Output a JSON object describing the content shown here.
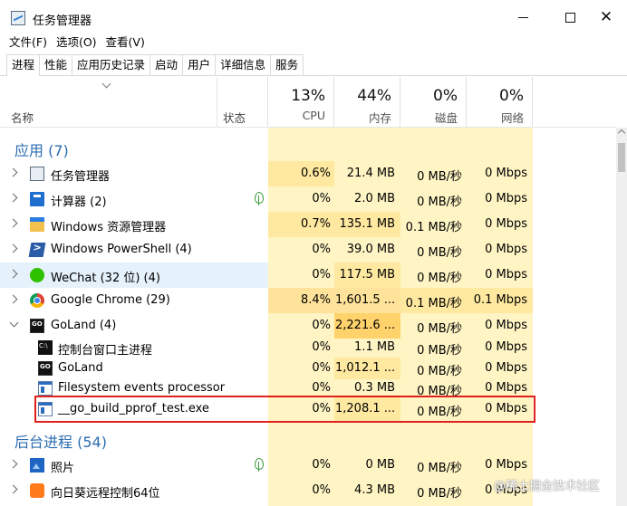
{
  "window": {
    "title": "任务管理器"
  },
  "menu": [
    "文件(F)",
    "选项(O)",
    "查看(V)"
  ],
  "tabs": [
    "进程",
    "性能",
    "应用历史记录",
    "启动",
    "用户",
    "详细信息",
    "服务"
  ],
  "columns": {
    "name": "名称",
    "status": "状态",
    "cpu": {
      "pct": "13%",
      "label": "CPU"
    },
    "memory": {
      "pct": "44%",
      "label": "内存"
    },
    "disk": {
      "pct": "0%",
      "label": "磁盘"
    },
    "network": {
      "pct": "0%",
      "label": "网络"
    }
  },
  "sections": {
    "apps": "应用 (7)",
    "background": "后台进程 (54)"
  },
  "rows": [
    {
      "name": "任务管理器",
      "icon": "task-manager-icon",
      "cpu": "0.6%",
      "mem": "21.4 MB",
      "disk": "0 MB/秒",
      "net": "0 Mbps"
    },
    {
      "name": "计算器 (2)",
      "icon": "calculator-icon",
      "cpu": "0%",
      "mem": "2.0 MB",
      "disk": "0 MB/秒",
      "net": "0 Mbps"
    },
    {
      "name": "Windows 资源管理器",
      "icon": "folder-icon",
      "cpu": "0.7%",
      "mem": "135.1 MB",
      "disk": "0.1 MB/秒",
      "net": "0 Mbps"
    },
    {
      "name": "Windows PowerShell (4)",
      "icon": "powershell-icon",
      "cpu": "0%",
      "mem": "39.0 MB",
      "disk": "0 MB/秒",
      "net": "0 Mbps"
    },
    {
      "name": "WeChat (32 位) (4)",
      "icon": "wechat-icon",
      "cpu": "0%",
      "mem": "117.5 MB",
      "disk": "0 MB/秒",
      "net": "0 Mbps"
    },
    {
      "name": "Google Chrome (29)",
      "icon": "chrome-icon",
      "cpu": "8.4%",
      "mem": "1,601.5 ...",
      "disk": "0.1 MB/秒",
      "net": "0.1 Mbps"
    },
    {
      "name": "GoLand (4)",
      "icon": "goland-icon",
      "cpu": "0%",
      "mem": "2,221.6 ...",
      "disk": "0 MB/秒",
      "net": "0 Mbps"
    },
    {
      "name": "控制台窗口主进程",
      "icon": "console-icon",
      "cpu": "0%",
      "mem": "1.1 MB",
      "disk": "0 MB/秒",
      "net": "0 Mbps"
    },
    {
      "name": "GoLand",
      "icon": "goland-icon",
      "cpu": "0%",
      "mem": "1,012.1 ...",
      "disk": "0 MB/秒",
      "net": "0 Mbps"
    },
    {
      "name": "Filesystem events processor",
      "icon": "window-icon",
      "cpu": "0%",
      "mem": "0.3 MB",
      "disk": "0 MB/秒",
      "net": "0 Mbps"
    },
    {
      "name": "__go_build_pprof_test.exe",
      "icon": "window-icon",
      "cpu": "0%",
      "mem": "1,208.1 ...",
      "disk": "0 MB/秒",
      "net": "0 Mbps"
    },
    {
      "name": "照片",
      "icon": "photos-icon",
      "cpu": "0%",
      "mem": "0 MB",
      "disk": "0 MB/秒",
      "net": "0 Mbps"
    },
    {
      "name": "向日葵远程控制64位",
      "icon": "sunlogin-icon",
      "cpu": "0%",
      "mem": "4.3 MB",
      "disk": "0 MB/秒",
      "net": "0 Mbps"
    }
  ],
  "watermark": "@稀土掘金技术社区",
  "colors": {
    "heat_light": "#fff4c4",
    "heat_mid": "#ffe9a0",
    "heat_strong": "#ffd26b",
    "section_blue": "#2b6cb0",
    "highlight_red": "#e0201c",
    "selected_row": "#e5f1fb"
  }
}
